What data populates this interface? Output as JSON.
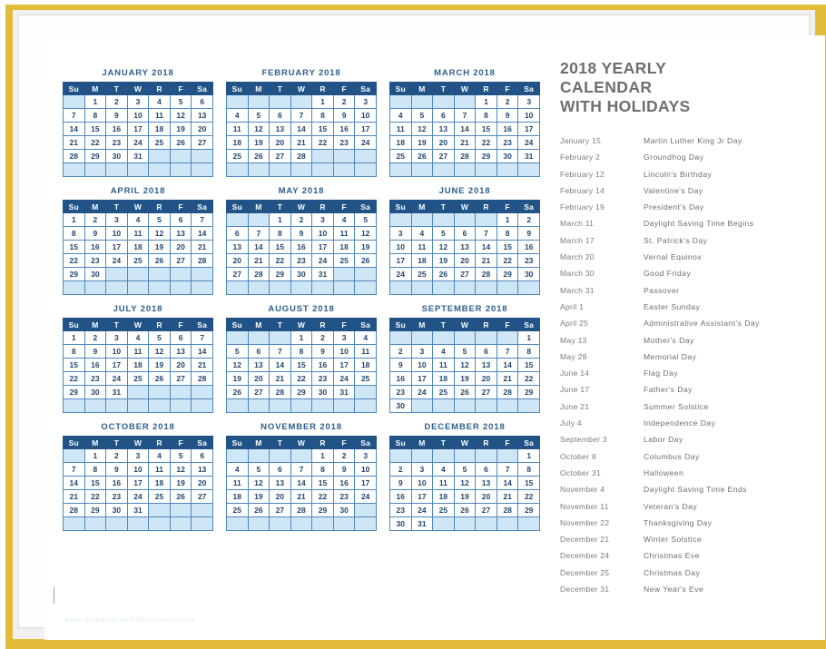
{
  "page": {
    "frame_color": "#e3bc3a",
    "paper_color": "#ffffff",
    "header_blue": "#215387",
    "empty_cell_blue": "#cfe6f7",
    "grid_line_blue": "#4e88bd",
    "title_gray": "#6d6e70",
    "month_title_blue": "#2d5f8f",
    "watermark": "www.thebalancesmallbusiness.com"
  },
  "side": {
    "title_lines": [
      "2018 YEARLY",
      "CALENDAR",
      "WITH HOLIDAYS"
    ],
    "holidays": [
      {
        "date": "January 15",
        "name": "Martin Luther King Jr Day"
      },
      {
        "date": "February 2",
        "name": "Groundhog Day"
      },
      {
        "date": "February 12",
        "name": "Lincoln's Birthday"
      },
      {
        "date": "February 14",
        "name": "Valentine's Day"
      },
      {
        "date": "February 19",
        "name": "President's Day"
      },
      {
        "date": "March 11",
        "name": "Daylight Saving Time Begins"
      },
      {
        "date": "March 17",
        "name": "St. Patrick's Day"
      },
      {
        "date": "March 20",
        "name": "Vernal Equinox"
      },
      {
        "date": "March 30",
        "name": "Good Friday"
      },
      {
        "date": "March 31",
        "name": "Passover"
      },
      {
        "date": "April 1",
        "name": "Easter Sunday"
      },
      {
        "date": "April 25",
        "name": "Administrative Assistant's Day"
      },
      {
        "date": "May 13",
        "name": "Mother's Day"
      },
      {
        "date": "May 28",
        "name": "Memorial Day"
      },
      {
        "date": "June 14",
        "name": "Flag Day"
      },
      {
        "date": "June 17",
        "name": "Father's Day"
      },
      {
        "date": "June 21",
        "name": "Summer Solstice"
      },
      {
        "date": "July 4",
        "name": "Independence Day"
      },
      {
        "date": "September 3",
        "name": "Labor Day"
      },
      {
        "date": "October 8",
        "name": "Columbus Day"
      },
      {
        "date": "October 31",
        "name": "Halloween"
      },
      {
        "date": "November 4",
        "name": "Daylight Saving Time Ends"
      },
      {
        "date": "November 11",
        "name": "Veteran's Day"
      },
      {
        "date": "November 22",
        "name": "Thanksgiving Day"
      },
      {
        "date": "December 21",
        "name": "Winter Solstice"
      },
      {
        "date": "December 24",
        "name": "Christmas Eve"
      },
      {
        "date": "December 25",
        "name": "Christmas Day"
      },
      {
        "date": "December 31",
        "name": "New Year's Eve"
      }
    ]
  },
  "calendar": {
    "year": 2018,
    "weekday_headers": [
      "Su",
      "M",
      "T",
      "W",
      "R",
      "F",
      "Sa"
    ],
    "months": [
      {
        "title": "JANUARY 2018",
        "weeks": [
          [
            "",
            "1",
            "2",
            "3",
            "4",
            "5",
            "6"
          ],
          [
            "7",
            "8",
            "9",
            "10",
            "11",
            "12",
            "13"
          ],
          [
            "14",
            "15",
            "16",
            "17",
            "18",
            "19",
            "20"
          ],
          [
            "21",
            "22",
            "23",
            "24",
            "25",
            "26",
            "27"
          ],
          [
            "28",
            "29",
            "30",
            "31",
            "",
            "",
            ""
          ],
          [
            "",
            "",
            "",
            "",
            "",
            "",
            ""
          ]
        ]
      },
      {
        "title": "FEBRUARY 2018",
        "weeks": [
          [
            "",
            "",
            "",
            "",
            "1",
            "2",
            "3"
          ],
          [
            "4",
            "5",
            "6",
            "7",
            "8",
            "9",
            "10"
          ],
          [
            "11",
            "12",
            "13",
            "14",
            "15",
            "16",
            "17"
          ],
          [
            "18",
            "19",
            "20",
            "21",
            "22",
            "23",
            "24"
          ],
          [
            "25",
            "26",
            "27",
            "28",
            "",
            "",
            ""
          ],
          [
            "",
            "",
            "",
            "",
            "",
            "",
            ""
          ]
        ]
      },
      {
        "title": "MARCH 2018",
        "weeks": [
          [
            "",
            "",
            "",
            "",
            "1",
            "2",
            "3"
          ],
          [
            "4",
            "5",
            "6",
            "7",
            "8",
            "9",
            "10"
          ],
          [
            "11",
            "12",
            "13",
            "14",
            "15",
            "16",
            "17"
          ],
          [
            "18",
            "19",
            "20",
            "21",
            "22",
            "23",
            "24"
          ],
          [
            "25",
            "26",
            "27",
            "28",
            "29",
            "30",
            "31"
          ],
          [
            "",
            "",
            "",
            "",
            "",
            "",
            ""
          ]
        ]
      },
      {
        "title": "APRIL 2018",
        "weeks": [
          [
            "1",
            "2",
            "3",
            "4",
            "5",
            "6",
            "7"
          ],
          [
            "8",
            "9",
            "10",
            "11",
            "12",
            "13",
            "14"
          ],
          [
            "15",
            "16",
            "17",
            "18",
            "19",
            "20",
            "21"
          ],
          [
            "22",
            "23",
            "24",
            "25",
            "26",
            "27",
            "28"
          ],
          [
            "29",
            "30",
            "",
            "",
            "",
            "",
            ""
          ],
          [
            "",
            "",
            "",
            "",
            "",
            "",
            ""
          ]
        ]
      },
      {
        "title": "MAY 2018",
        "weeks": [
          [
            "",
            "",
            "1",
            "2",
            "3",
            "4",
            "5"
          ],
          [
            "6",
            "7",
            "8",
            "9",
            "10",
            "11",
            "12"
          ],
          [
            "13",
            "14",
            "15",
            "16",
            "17",
            "18",
            "19"
          ],
          [
            "20",
            "21",
            "22",
            "23",
            "24",
            "25",
            "26"
          ],
          [
            "27",
            "28",
            "29",
            "30",
            "31",
            "",
            ""
          ],
          [
            "",
            "",
            "",
            "",
            "",
            "",
            ""
          ]
        ]
      },
      {
        "title": "JUNE 2018",
        "weeks": [
          [
            "",
            "",
            "",
            "",
            "",
            "1",
            "2"
          ],
          [
            "3",
            "4",
            "5",
            "6",
            "7",
            "8",
            "9"
          ],
          [
            "10",
            "11",
            "12",
            "13",
            "14",
            "15",
            "16"
          ],
          [
            "17",
            "18",
            "19",
            "20",
            "21",
            "22",
            "23"
          ],
          [
            "24",
            "25",
            "26",
            "27",
            "28",
            "29",
            "30"
          ],
          [
            "",
            "",
            "",
            "",
            "",
            "",
            ""
          ]
        ]
      },
      {
        "title": "JULY 2018",
        "weeks": [
          [
            "1",
            "2",
            "3",
            "4",
            "5",
            "6",
            "7"
          ],
          [
            "8",
            "9",
            "10",
            "11",
            "12",
            "13",
            "14"
          ],
          [
            "15",
            "16",
            "17",
            "18",
            "19",
            "20",
            "21"
          ],
          [
            "22",
            "23",
            "24",
            "25",
            "26",
            "27",
            "28"
          ],
          [
            "29",
            "30",
            "31",
            "",
            "",
            "",
            ""
          ],
          [
            "",
            "",
            "",
            "",
            "",
            "",
            ""
          ]
        ]
      },
      {
        "title": "AUGUST 2018",
        "weeks": [
          [
            "",
            "",
            "",
            "1",
            "2",
            "3",
            "4"
          ],
          [
            "5",
            "6",
            "7",
            "8",
            "9",
            "10",
            "11"
          ],
          [
            "12",
            "13",
            "14",
            "15",
            "16",
            "17",
            "18"
          ],
          [
            "19",
            "20",
            "21",
            "22",
            "23",
            "24",
            "25"
          ],
          [
            "26",
            "27",
            "28",
            "29",
            "30",
            "31",
            ""
          ],
          [
            "",
            "",
            "",
            "",
            "",
            "",
            ""
          ]
        ]
      },
      {
        "title": "SEPTEMBER 2018",
        "weeks": [
          [
            "",
            "",
            "",
            "",
            "",
            "",
            "1"
          ],
          [
            "2",
            "3",
            "4",
            "5",
            "6",
            "7",
            "8"
          ],
          [
            "9",
            "10",
            "11",
            "12",
            "13",
            "14",
            "15"
          ],
          [
            "16",
            "17",
            "18",
            "19",
            "20",
            "21",
            "22"
          ],
          [
            "23",
            "24",
            "25",
            "26",
            "27",
            "28",
            "29"
          ],
          [
            "30",
            "",
            "",
            "",
            "",
            "",
            ""
          ]
        ]
      },
      {
        "title": "OCTOBER 2018",
        "weeks": [
          [
            "",
            "1",
            "2",
            "3",
            "4",
            "5",
            "6"
          ],
          [
            "7",
            "8",
            "9",
            "10",
            "11",
            "12",
            "13"
          ],
          [
            "14",
            "15",
            "16",
            "17",
            "18",
            "19",
            "20"
          ],
          [
            "21",
            "22",
            "23",
            "24",
            "25",
            "26",
            "27"
          ],
          [
            "28",
            "29",
            "30",
            "31",
            "",
            "",
            ""
          ],
          [
            "",
            "",
            "",
            "",
            "",
            "",
            ""
          ]
        ]
      },
      {
        "title": "NOVEMBER 2018",
        "weeks": [
          [
            "",
            "",
            "",
            "",
            "1",
            "2",
            "3"
          ],
          [
            "4",
            "5",
            "6",
            "7",
            "8",
            "9",
            "10"
          ],
          [
            "11",
            "12",
            "13",
            "14",
            "15",
            "16",
            "17"
          ],
          [
            "18",
            "19",
            "20",
            "21",
            "22",
            "23",
            "24"
          ],
          [
            "25",
            "26",
            "27",
            "28",
            "29",
            "30",
            ""
          ],
          [
            "",
            "",
            "",
            "",
            "",
            "",
            ""
          ]
        ]
      },
      {
        "title": "DECEMBER 2018",
        "weeks": [
          [
            "",
            "",
            "",
            "",
            "",
            "",
            "1"
          ],
          [
            "2",
            "3",
            "4",
            "5",
            "6",
            "7",
            "8"
          ],
          [
            "9",
            "10",
            "11",
            "12",
            "13",
            "14",
            "15"
          ],
          [
            "16",
            "17",
            "18",
            "19",
            "20",
            "21",
            "22"
          ],
          [
            "23",
            "24",
            "25",
            "26",
            "27",
            "28",
            "29"
          ],
          [
            "30",
            "31",
            "",
            "",
            "",
            "",
            ""
          ]
        ]
      }
    ]
  }
}
